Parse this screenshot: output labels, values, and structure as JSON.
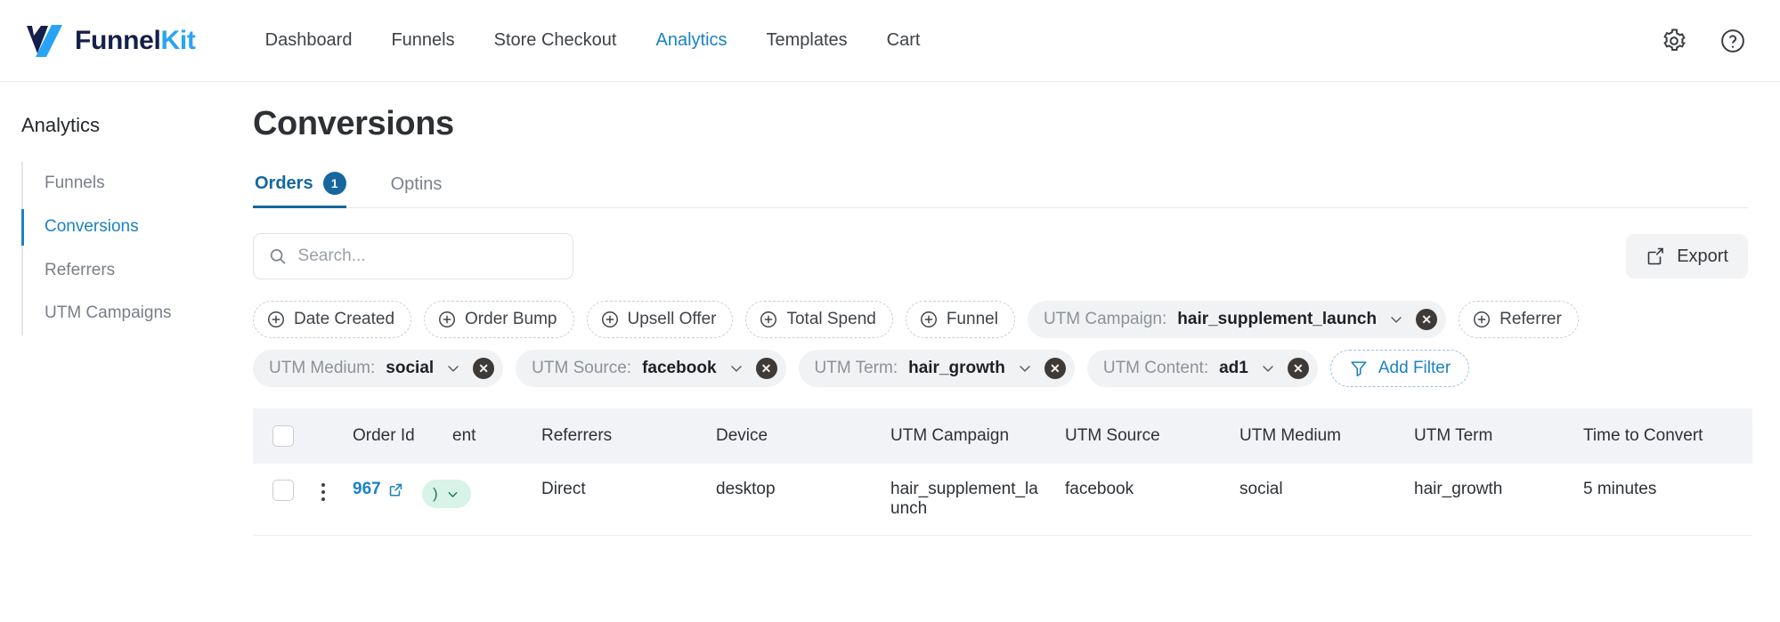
{
  "header": {
    "brand": {
      "name_dark": "Funnel",
      "name_blue": "Kit",
      "logo_icon": "funnelkit-logo-icon"
    },
    "nav": [
      {
        "label": "Dashboard",
        "active": false
      },
      {
        "label": "Funnels",
        "active": false
      },
      {
        "label": "Store Checkout",
        "active": false
      },
      {
        "label": "Analytics",
        "active": true
      },
      {
        "label": "Templates",
        "active": false
      },
      {
        "label": "Cart",
        "active": false
      }
    ],
    "settings_icon": "gear-icon",
    "help_icon": "question-circle-icon"
  },
  "sidebar": {
    "title": "Analytics",
    "items": [
      {
        "label": "Funnels",
        "active": false
      },
      {
        "label": "Conversions",
        "active": true
      },
      {
        "label": "Referrers",
        "active": false
      },
      {
        "label": "UTM Campaigns",
        "active": false
      }
    ]
  },
  "main": {
    "page_title": "Conversions",
    "tabs": [
      {
        "label": "Orders",
        "badge": "1",
        "active": true
      },
      {
        "label": "Optins",
        "badge": "",
        "active": false
      }
    ],
    "search": {
      "value": "",
      "placeholder": "Search...",
      "icon": "search-icon"
    },
    "export": {
      "label": "Export",
      "icon": "export-icon"
    },
    "filters": {
      "available": [
        {
          "label": "Date Created"
        },
        {
          "label": "Order Bump"
        },
        {
          "label": "Upsell Offer"
        },
        {
          "label": "Total Spend"
        },
        {
          "label": "Funnel"
        },
        {
          "label": "Referrer"
        }
      ],
      "applied": [
        {
          "label": "UTM Campaign:",
          "value": "hair_supplement_launch"
        },
        {
          "label": "UTM Medium:",
          "value": "social"
        },
        {
          "label": "UTM Source:",
          "value": "facebook"
        },
        {
          "label": "UTM Term:",
          "value": "hair_growth"
        },
        {
          "label": "UTM Content:",
          "value": "ad1"
        }
      ],
      "add_filter": {
        "label": "Add Filter",
        "icon": "funnel-icon"
      }
    },
    "table": {
      "columns": [
        "Order Id",
        "ent",
        "Referrers",
        "Device",
        "UTM Campaign",
        "UTM Source",
        "UTM Medium",
        "UTM Term",
        "Time to Convert"
      ],
      "rows": [
        {
          "order_id": "967",
          "status": ")",
          "referrers": "Direct",
          "device": "desktop",
          "utm_campaign": "hair_supplement_launch",
          "utm_source": "facebook",
          "utm_medium": "social",
          "utm_term": "hair_growth",
          "time_to_convert": "5 minutes"
        }
      ]
    }
  },
  "colors": {
    "accent_blue": "#1b82c4",
    "tab_blue": "#17679e",
    "brand_blue": "#29a3f5",
    "brand_navy": "#14204a",
    "status_green_bg": "#d8f3e7",
    "status_green_fg": "#1d7a56",
    "header_row_bg": "#f2f3f7"
  }
}
